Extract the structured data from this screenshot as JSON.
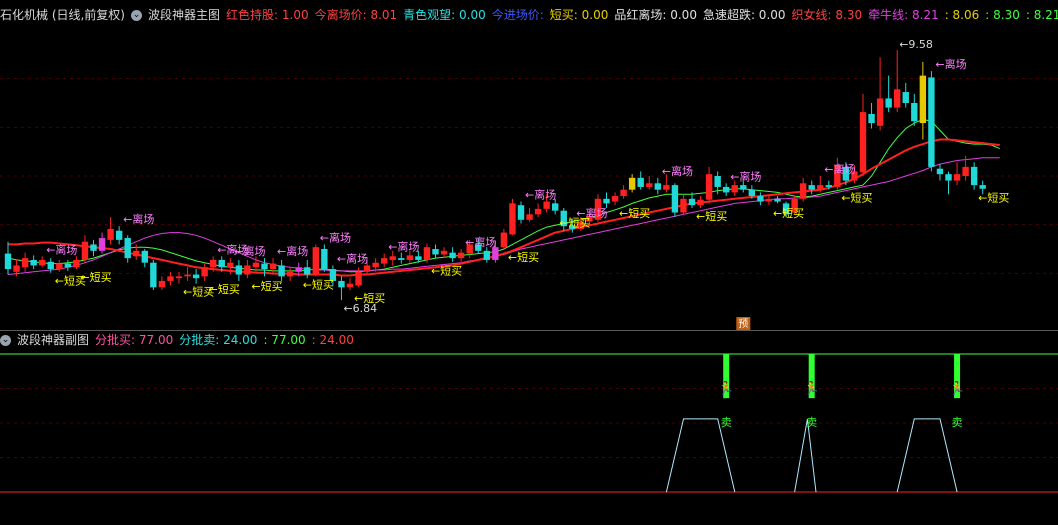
{
  "main_panel": {
    "header": [
      {
        "text": "石化机械 (日线,前复权)",
        "color": "#d8d8d8"
      },
      {
        "text": "波段神器主图",
        "color": "#d8d8d8"
      },
      {
        "text": "红色持股: 1.00",
        "color": "#ff4040"
      },
      {
        "text": "今离场价: 8.01",
        "color": "#ff4040"
      },
      {
        "text": "青色观望: 0.00",
        "color": "#28e0e0"
      },
      {
        "text": "今进场价:",
        "color": "#3a58ff"
      },
      {
        "text": "短买: 0.00",
        "color": "#e6d200"
      },
      {
        "text": "品红离场: 0.00",
        "color": "#e0e0e0"
      },
      {
        "text": "急速超跌: 0.00",
        "color": "#e0e0e0"
      },
      {
        "text": "织女线: 8.30",
        "color": "#ff4040"
      },
      {
        "text": "牵牛线: 8.21",
        "color": "#e040e0"
      },
      {
        "text": ": 8.06",
        "color": "#e6d200"
      },
      {
        "text": ": 8.30",
        "color": "#40ff40"
      },
      {
        "text": ": 8.21",
        "color": "#40ff40"
      }
    ]
  },
  "sub_panel": {
    "header": [
      {
        "text": "波段神器副图",
        "color": "#d8d8d8"
      },
      {
        "text": "分批买: 77.00",
        "color": "#ff50a0"
      },
      {
        "text": "分批卖: 24.00",
        "color": "#28e0e0"
      },
      {
        "text": ": 77.00",
        "color": "#40ff40"
      },
      {
        "text": ": 24.00",
        "color": "#ff4040"
      }
    ]
  },
  "labels": {
    "leave": "←离场",
    "buy": "←短买",
    "sell": "卖",
    "forecast": "预",
    "high": "←9.58",
    "low": "←6.84"
  },
  "colors": {
    "up": "#ff2020",
    "down": "#20d8d8",
    "up_yellow": "#e6c800",
    "up_magenta": "#e040e0",
    "red_line": "#ff2020",
    "magenta_line": "#e040e0",
    "green_line": "#40ff40",
    "grid": "#4a0000",
    "leave_text": "#ff80ff",
    "buy_text": "#ffff00"
  },
  "chart_data": {
    "type": "candlestick",
    "y_axis_range": [
      6.6,
      9.8
    ],
    "high_value": 9.58,
    "low_value": 6.84,
    "candles": [
      {
        "o": 7.35,
        "c": 7.18,
        "h": 7.48,
        "l": 7.12
      },
      {
        "o": 7.15,
        "c": 7.22,
        "h": 7.28,
        "l": 7.1
      },
      {
        "o": 7.2,
        "c": 7.3,
        "h": 7.36,
        "l": 7.15
      },
      {
        "o": 7.28,
        "c": 7.22,
        "h": 7.33,
        "l": 7.18
      },
      {
        "o": 7.22,
        "c": 7.28,
        "h": 7.32,
        "l": 7.2
      },
      {
        "o": 7.26,
        "c": 7.18,
        "h": 7.3,
        "l": 7.14
      },
      {
        "o": 7.18,
        "c": 7.24,
        "h": 7.28,
        "l": 7.15
      },
      {
        "o": 7.24,
        "c": 7.2,
        "h": 7.28,
        "l": 7.16
      },
      {
        "o": 7.2,
        "c": 7.28,
        "h": 7.32,
        "l": 7.18
      },
      {
        "o": 7.28,
        "c": 7.48,
        "h": 7.55,
        "l": 7.25
      },
      {
        "o": 7.45,
        "c": 7.38,
        "h": 7.5,
        "l": 7.32
      },
      {
        "o": 7.38,
        "c": 7.52,
        "h": 7.58,
        "l": 7.35
      },
      {
        "o": 7.5,
        "c": 7.62,
        "h": 7.75,
        "l": 7.45
      },
      {
        "o": 7.6,
        "c": 7.5,
        "h": 7.65,
        "l": 7.45
      },
      {
        "o": 7.52,
        "c": 7.3,
        "h": 7.55,
        "l": 7.25
      },
      {
        "o": 7.32,
        "c": 7.38,
        "h": 7.45,
        "l": 7.28
      },
      {
        "o": 7.38,
        "c": 7.25,
        "h": 7.4,
        "l": 7.2
      },
      {
        "o": 7.25,
        "c": 6.98,
        "h": 7.28,
        "l": 6.95
      },
      {
        "o": 6.98,
        "c": 7.05,
        "h": 7.1,
        "l": 6.95
      },
      {
        "o": 7.05,
        "c": 7.1,
        "h": 7.15,
        "l": 7.0
      },
      {
        "o": 7.08,
        "c": 7.1,
        "h": 7.15,
        "l": 7.02
      },
      {
        "o": 7.1,
        "c": 7.12,
        "h": 7.2,
        "l": 7.05
      },
      {
        "o": 7.12,
        "c": 7.08,
        "h": 7.18,
        "l": 7.02
      },
      {
        "o": 7.1,
        "c": 7.2,
        "h": 7.25,
        "l": 7.05
      },
      {
        "o": 7.2,
        "c": 7.28,
        "h": 7.32,
        "l": 7.15
      },
      {
        "o": 7.28,
        "c": 7.2,
        "h": 7.32,
        "l": 7.15
      },
      {
        "o": 7.2,
        "c": 7.25,
        "h": 7.3,
        "l": 7.12
      },
      {
        "o": 7.22,
        "c": 7.12,
        "h": 7.28,
        "l": 7.05
      },
      {
        "o": 7.12,
        "c": 7.22,
        "h": 7.28,
        "l": 7.08
      },
      {
        "o": 7.2,
        "c": 7.25,
        "h": 7.32,
        "l": 7.15
      },
      {
        "o": 7.24,
        "c": 7.18,
        "h": 7.3,
        "l": 7.1
      },
      {
        "o": 7.18,
        "c": 7.24,
        "h": 7.3,
        "l": 7.12
      },
      {
        "o": 7.22,
        "c": 7.1,
        "h": 7.28,
        "l": 7.05
      },
      {
        "o": 7.1,
        "c": 7.15,
        "h": 7.2,
        "l": 7.05
      },
      {
        "o": 7.15,
        "c": 7.2,
        "h": 7.25,
        "l": 7.1
      },
      {
        "o": 7.2,
        "c": 7.12,
        "h": 7.28,
        "l": 7.08
      },
      {
        "o": 7.12,
        "c": 7.42,
        "h": 7.45,
        "l": 7.1
      },
      {
        "o": 7.4,
        "c": 7.18,
        "h": 7.45,
        "l": 7.15
      },
      {
        "o": 7.18,
        "c": 7.05,
        "h": 7.22,
        "l": 7.0
      },
      {
        "o": 7.05,
        "c": 6.98,
        "h": 7.1,
        "l": 6.84
      },
      {
        "o": 6.98,
        "c": 7.02,
        "h": 7.08,
        "l": 6.95
      },
      {
        "o": 7.0,
        "c": 7.15,
        "h": 7.2,
        "l": 6.98
      },
      {
        "o": 7.15,
        "c": 7.22,
        "h": 7.28,
        "l": 7.12
      },
      {
        "o": 7.2,
        "c": 7.25,
        "h": 7.3,
        "l": 7.15
      },
      {
        "o": 7.24,
        "c": 7.3,
        "h": 7.35,
        "l": 7.2
      },
      {
        "o": 7.28,
        "c": 7.32,
        "h": 7.38,
        "l": 7.22
      },
      {
        "o": 7.3,
        "c": 7.28,
        "h": 7.36,
        "l": 7.24
      },
      {
        "o": 7.28,
        "c": 7.33,
        "h": 7.38,
        "l": 7.25
      },
      {
        "o": 7.32,
        "c": 7.28,
        "h": 7.38,
        "l": 7.25
      },
      {
        "o": 7.28,
        "c": 7.42,
        "h": 7.46,
        "l": 7.25
      },
      {
        "o": 7.4,
        "c": 7.34,
        "h": 7.45,
        "l": 7.3
      },
      {
        "o": 7.34,
        "c": 7.38,
        "h": 7.42,
        "l": 7.3
      },
      {
        "o": 7.36,
        "c": 7.3,
        "h": 7.42,
        "l": 7.26
      },
      {
        "o": 7.3,
        "c": 7.36,
        "h": 7.4,
        "l": 7.26
      },
      {
        "o": 7.35,
        "c": 7.45,
        "h": 7.5,
        "l": 7.3
      },
      {
        "o": 7.45,
        "c": 7.38,
        "h": 7.52,
        "l": 7.35
      },
      {
        "o": 7.38,
        "c": 7.28,
        "h": 7.42,
        "l": 7.25
      },
      {
        "o": 7.28,
        "c": 7.42,
        "h": 7.48,
        "l": 7.25
      },
      {
        "o": 7.42,
        "c": 7.58,
        "h": 7.62,
        "l": 7.4
      },
      {
        "o": 7.56,
        "c": 7.9,
        "h": 7.95,
        "l": 7.55
      },
      {
        "o": 7.88,
        "c": 7.72,
        "h": 7.92,
        "l": 7.68
      },
      {
        "o": 7.72,
        "c": 7.78,
        "h": 7.85,
        "l": 7.7
      },
      {
        "o": 7.78,
        "c": 7.84,
        "h": 7.9,
        "l": 7.75
      },
      {
        "o": 7.84,
        "c": 7.92,
        "h": 8.0,
        "l": 7.8
      },
      {
        "o": 7.9,
        "c": 7.82,
        "h": 7.95,
        "l": 7.78
      },
      {
        "o": 7.82,
        "c": 7.65,
        "h": 7.85,
        "l": 7.6
      },
      {
        "o": 7.66,
        "c": 7.62,
        "h": 7.72,
        "l": 7.58
      },
      {
        "o": 7.62,
        "c": 7.7,
        "h": 7.75,
        "l": 7.6
      },
      {
        "o": 7.7,
        "c": 7.76,
        "h": 7.82,
        "l": 7.66
      },
      {
        "o": 7.72,
        "c": 7.95,
        "h": 8.0,
        "l": 7.7
      },
      {
        "o": 7.95,
        "c": 7.9,
        "h": 8.02,
        "l": 7.85
      },
      {
        "o": 7.92,
        "c": 7.98,
        "h": 8.02,
        "l": 7.88
      },
      {
        "o": 7.98,
        "c": 8.05,
        "h": 8.1,
        "l": 7.95
      },
      {
        "o": 8.05,
        "c": 8.18,
        "h": 8.22,
        "l": 8.02
      },
      {
        "o": 8.18,
        "c": 8.08,
        "h": 8.25,
        "l": 8.05
      },
      {
        "o": 8.08,
        "c": 8.12,
        "h": 8.2,
        "l": 8.05
      },
      {
        "o": 8.12,
        "c": 8.05,
        "h": 8.18,
        "l": 8.0
      },
      {
        "o": 8.05,
        "c": 8.1,
        "h": 8.22,
        "l": 8.02
      },
      {
        "o": 8.1,
        "c": 7.8,
        "h": 8.12,
        "l": 7.75
      },
      {
        "o": 7.8,
        "c": 7.95,
        "h": 8.0,
        "l": 7.78
      },
      {
        "o": 7.95,
        "c": 7.88,
        "h": 8.02,
        "l": 7.85
      },
      {
        "o": 7.88,
        "c": 7.94,
        "h": 7.98,
        "l": 7.85
      },
      {
        "o": 7.94,
        "c": 8.22,
        "h": 8.3,
        "l": 7.9
      },
      {
        "o": 8.2,
        "c": 8.08,
        "h": 8.25,
        "l": 8.0
      },
      {
        "o": 8.08,
        "c": 8.02,
        "h": 8.12,
        "l": 7.98
      },
      {
        "o": 8.02,
        "c": 8.1,
        "h": 8.15,
        "l": 7.98
      },
      {
        "o": 8.1,
        "c": 8.05,
        "h": 8.15,
        "l": 8.02
      },
      {
        "o": 8.05,
        "c": 7.98,
        "h": 8.1,
        "l": 7.95
      },
      {
        "o": 7.98,
        "c": 7.92,
        "h": 8.02,
        "l": 7.88
      },
      {
        "o": 7.92,
        "c": 7.95,
        "h": 8.0,
        "l": 7.88
      },
      {
        "o": 7.95,
        "c": 7.92,
        "h": 7.98,
        "l": 7.9
      },
      {
        "o": 7.9,
        "c": 7.78,
        "h": 7.92,
        "l": 7.75
      },
      {
        "o": 7.8,
        "c": 7.95,
        "h": 7.98,
        "l": 7.78
      },
      {
        "o": 7.95,
        "c": 8.12,
        "h": 8.18,
        "l": 7.92
      },
      {
        "o": 8.1,
        "c": 8.05,
        "h": 8.15,
        "l": 8.0
      },
      {
        "o": 8.05,
        "c": 8.1,
        "h": 8.2,
        "l": 8.02
      },
      {
        "o": 8.1,
        "c": 8.08,
        "h": 8.15,
        "l": 8.05
      },
      {
        "o": 8.08,
        "c": 8.32,
        "h": 8.4,
        "l": 8.05
      },
      {
        "o": 8.3,
        "c": 8.15,
        "h": 8.35,
        "l": 8.1
      },
      {
        "o": 8.15,
        "c": 8.25,
        "h": 8.32,
        "l": 8.12
      },
      {
        "o": 8.24,
        "c": 8.9,
        "h": 9.1,
        "l": 8.2
      },
      {
        "o": 8.88,
        "c": 8.78,
        "h": 9.0,
        "l": 8.72
      },
      {
        "o": 8.75,
        "c": 9.05,
        "h": 9.5,
        "l": 8.7
      },
      {
        "o": 9.05,
        "c": 8.95,
        "h": 9.3,
        "l": 8.9
      },
      {
        "o": 8.95,
        "c": 9.15,
        "h": 9.58,
        "l": 8.9
      },
      {
        "o": 9.12,
        "c": 9.0,
        "h": 9.22,
        "l": 8.95
      },
      {
        "o": 9.0,
        "c": 8.8,
        "h": 9.1,
        "l": 8.75
      },
      {
        "o": 8.78,
        "c": 9.3,
        "h": 9.45,
        "l": 8.6
      },
      {
        "o": 9.28,
        "c": 8.3,
        "h": 9.35,
        "l": 8.25
      },
      {
        "o": 8.28,
        "c": 8.22,
        "h": 8.33,
        "l": 8.15
      },
      {
        "o": 8.22,
        "c": 8.15,
        "h": 8.25,
        "l": 8.0
      },
      {
        "o": 8.15,
        "c": 8.22,
        "h": 8.35,
        "l": 8.1
      },
      {
        "o": 8.2,
        "c": 8.3,
        "h": 8.42,
        "l": 8.15
      },
      {
        "o": 8.3,
        "c": 8.1,
        "h": 8.35,
        "l": 8.05
      },
      {
        "o": 8.1,
        "c": 8.06,
        "h": 8.15,
        "l": 8.0
      }
    ],
    "red_line": [
      7.45,
      7.45,
      7.46,
      7.46,
      7.47,
      7.47,
      7.46,
      7.45,
      7.44,
      7.43,
      7.42,
      7.41,
      7.4,
      7.38,
      7.36,
      7.34,
      7.32,
      7.3,
      7.28,
      7.26,
      7.24,
      7.22,
      7.2,
      7.19,
      7.18,
      7.17,
      7.16,
      7.15,
      7.15,
      7.14,
      7.14,
      7.13,
      7.13,
      7.13,
      7.12,
      7.12,
      7.12,
      7.12,
      7.12,
      7.11,
      7.11,
      7.12,
      7.12,
      7.13,
      7.14,
      7.15,
      7.16,
      7.17,
      7.18,
      7.19,
      7.2,
      7.21,
      7.22,
      7.24,
      7.26,
      7.28,
      7.3,
      7.32,
      7.35,
      7.38,
      7.42,
      7.46,
      7.5,
      7.54,
      7.58,
      7.6,
      7.62,
      7.64,
      7.66,
      7.68,
      7.7,
      7.72,
      7.74,
      7.76,
      7.78,
      7.8,
      7.82,
      7.84,
      7.86,
      7.88,
      7.9,
      7.91,
      7.92,
      7.93,
      7.94,
      7.95,
      7.96,
      7.97,
      7.98,
      7.99,
      8.0,
      8.01,
      8.02,
      8.03,
      8.04,
      8.05,
      8.07,
      8.1,
      8.13,
      8.17,
      8.22,
      8.28,
      8.33,
      8.38,
      8.43,
      8.48,
      8.52,
      8.55,
      8.58,
      8.6,
      8.6,
      8.59,
      8.58,
      8.57,
      8.56,
      8.55,
      8.54
    ],
    "magenta_line": [
      7.12,
      7.13,
      7.14,
      7.15,
      7.16,
      7.17,
      7.18,
      7.2,
      7.22,
      7.25,
      7.28,
      7.32,
      7.36,
      7.4,
      7.44,
      7.48,
      7.52,
      7.55,
      7.57,
      7.58,
      7.58,
      7.57,
      7.55,
      7.52,
      7.48,
      7.44,
      7.4,
      7.36,
      7.32,
      7.28,
      7.25,
      7.23,
      7.21,
      7.2,
      7.19,
      7.18,
      7.17,
      7.17,
      7.16,
      7.16,
      7.16,
      7.16,
      7.16,
      7.17,
      7.17,
      7.18,
      7.18,
      7.19,
      7.2,
      7.21,
      7.22,
      7.23,
      7.24,
      7.25,
      7.27,
      7.28,
      7.3,
      7.32,
      7.34,
      7.37,
      7.4,
      7.42,
      7.44,
      7.46,
      7.48,
      7.5,
      7.52,
      7.54,
      7.56,
      7.58,
      7.6,
      7.62,
      7.64,
      7.66,
      7.68,
      7.7,
      7.72,
      7.74,
      7.76,
      7.78,
      7.8,
      7.82,
      7.84,
      7.86,
      7.88,
      7.9,
      7.91,
      7.92,
      7.93,
      7.94,
      7.95,
      7.95,
      7.96,
      7.96,
      7.97,
      7.98,
      8.0,
      8.02,
      8.04,
      8.06,
      8.08,
      8.1,
      8.12,
      8.14,
      8.17,
      8.2,
      8.23,
      8.26,
      8.3,
      8.33,
      8.35,
      8.37,
      8.38,
      8.39,
      8.4,
      8.4,
      8.4
    ],
    "green_line": [
      7.3,
      7.28,
      7.27,
      7.26,
      7.25,
      7.24,
      7.24,
      7.25,
      7.26,
      7.28,
      7.3,
      7.33,
      7.36,
      7.39,
      7.41,
      7.42,
      7.42,
      7.41,
      7.39,
      7.36,
      7.33,
      7.3,
      7.27,
      7.25,
      7.23,
      7.21,
      7.2,
      7.19,
      7.18,
      7.17,
      7.17,
      7.16,
      7.16,
      7.16,
      7.16,
      7.17,
      7.18,
      7.18,
      7.17,
      7.16,
      7.15,
      7.15,
      7.16,
      7.17,
      7.18,
      7.2,
      7.22,
      7.24,
      7.26,
      7.28,
      7.3,
      7.31,
      7.32,
      7.33,
      7.34,
      7.35,
      7.36,
      7.37,
      7.4,
      7.45,
      7.5,
      7.55,
      7.6,
      7.64,
      7.66,
      7.68,
      7.7,
      7.72,
      7.74,
      7.77,
      7.8,
      7.83,
      7.86,
      7.9,
      7.93,
      7.96,
      7.98,
      8.0,
      8.0,
      8.0,
      8.0,
      8.01,
      8.02,
      8.04,
      8.05,
      8.06,
      8.06,
      8.05,
      8.04,
      8.03,
      8.02,
      8.0,
      7.98,
      7.97,
      7.98,
      8.0,
      8.02,
      8.04,
      8.06,
      8.08,
      8.1,
      8.2,
      8.35,
      8.5,
      8.62,
      8.72,
      8.78,
      8.82,
      8.8,
      8.7,
      8.6,
      8.58,
      8.56,
      8.55,
      8.55,
      8.54,
      8.5
    ],
    "leave_signals": [
      4,
      13,
      24,
      26,
      31,
      36,
      38,
      44,
      53,
      60,
      66,
      76,
      84,
      95,
      108
    ],
    "buy_signals": [
      5,
      8,
      20,
      23,
      28,
      34,
      40,
      49,
      58,
      64,
      71,
      80,
      89,
      97,
      113
    ],
    "sub_chart": {
      "y_range": [
        0,
        100
      ],
      "buy_level": 77,
      "sell_level": 24,
      "segments": [
        {
          "x": [
            77,
            79,
            83,
            85
          ],
          "y": [
            24,
            77,
            77,
            24
          ]
        },
        {
          "x": [
            92,
            93.5,
            94.5
          ],
          "y": [
            24,
            77,
            24
          ]
        },
        {
          "x": [
            104,
            106,
            109,
            111
          ],
          "y": [
            24,
            77,
            77,
            24
          ]
        }
      ],
      "sell_signals": [
        84,
        94,
        111
      ]
    }
  }
}
